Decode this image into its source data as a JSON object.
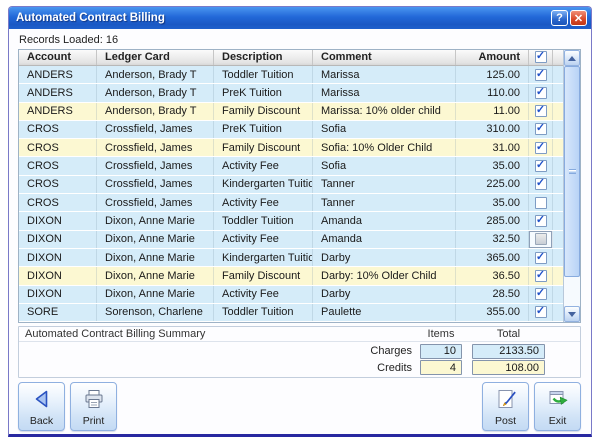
{
  "titlebar": {
    "title": "Automated Contract Billing",
    "help_glyph": "?",
    "close_glyph": "✕"
  },
  "records_loaded": "Records Loaded: 16",
  "table": {
    "columns": [
      "Account",
      "Ledger Card",
      "Description",
      "Comment",
      "Amount"
    ],
    "select_all_checked": true,
    "rows": [
      {
        "account": "ANDERS",
        "ledger": "Anderson, Brady T",
        "description": "Toddler Tuition",
        "comment": "Marissa",
        "amount": "125.00",
        "checked": true,
        "highlight": false,
        "focused": false
      },
      {
        "account": "ANDERS",
        "ledger": "Anderson, Brady T",
        "description": "PreK Tuition",
        "comment": "Marissa",
        "amount": "110.00",
        "checked": true,
        "highlight": false,
        "focused": false
      },
      {
        "account": "ANDERS",
        "ledger": "Anderson, Brady T",
        "description": "Family Discount",
        "comment": "Marissa: 10% older child",
        "amount": "11.00",
        "checked": true,
        "highlight": true,
        "focused": false
      },
      {
        "account": "CROS",
        "ledger": "Crossfield, James",
        "description": "PreK Tuition",
        "comment": "Sofia",
        "amount": "310.00",
        "checked": true,
        "highlight": false,
        "focused": false
      },
      {
        "account": "CROS",
        "ledger": "Crossfield, James",
        "description": "Family Discount",
        "comment": "Sofia: 10% Older Child",
        "amount": "31.00",
        "checked": true,
        "highlight": true,
        "focused": false
      },
      {
        "account": "CROS",
        "ledger": "Crossfield, James",
        "description": "Activity Fee",
        "comment": "Sofia",
        "amount": "35.00",
        "checked": true,
        "highlight": false,
        "focused": false
      },
      {
        "account": "CROS",
        "ledger": "Crossfield, James",
        "description": "Kindergarten Tuition",
        "comment": "Tanner",
        "amount": "225.00",
        "checked": true,
        "highlight": false,
        "focused": false
      },
      {
        "account": "CROS",
        "ledger": "Crossfield, James",
        "description": "Activity Fee",
        "comment": "Tanner",
        "amount": "35.00",
        "checked": false,
        "highlight": false,
        "focused": false
      },
      {
        "account": "DIXON",
        "ledger": "Dixon, Anne Marie",
        "description": "Toddler Tuition",
        "comment": "Amanda",
        "amount": "285.00",
        "checked": true,
        "highlight": false,
        "focused": false
      },
      {
        "account": "DIXON",
        "ledger": "Dixon, Anne Marie",
        "description": "Activity Fee",
        "comment": "Amanda",
        "amount": "32.50",
        "checked": false,
        "highlight": false,
        "focused": true
      },
      {
        "account": "DIXON",
        "ledger": "Dixon, Anne Marie",
        "description": "Kindergarten Tuition",
        "comment": "Darby",
        "amount": "365.00",
        "checked": true,
        "highlight": false,
        "focused": false
      },
      {
        "account": "DIXON",
        "ledger": "Dixon, Anne Marie",
        "description": "Family Discount",
        "comment": "Darby: 10% Older Child",
        "amount": "36.50",
        "checked": true,
        "highlight": true,
        "focused": false
      },
      {
        "account": "DIXON",
        "ledger": "Dixon, Anne Marie",
        "description": "Activity Fee",
        "comment": "Darby",
        "amount": "28.50",
        "checked": true,
        "highlight": false,
        "focused": false
      },
      {
        "account": "SORE",
        "ledger": "Sorenson, Charlene",
        "description": "Toddler Tuition",
        "comment": "Paulette",
        "amount": "355.00",
        "checked": true,
        "highlight": false,
        "focused": false
      }
    ]
  },
  "summary": {
    "title": "Automated Contract Billing Summary",
    "items_header": "Items",
    "total_header": "Total",
    "charges": {
      "label": "Charges",
      "items": "10",
      "total": "2133.50"
    },
    "credits": {
      "label": "Credits",
      "items": "4",
      "total": "108.00"
    }
  },
  "footer": {
    "buttons": [
      {
        "label": "Back",
        "icon": "back-arrow-icon"
      },
      {
        "label": "Print",
        "icon": "printer-icon"
      },
      {
        "label": "Post",
        "icon": "post-pen-icon"
      },
      {
        "label": "Exit",
        "icon": "exit-icon"
      }
    ]
  },
  "colors": {
    "row_blue": "#d5ecf9",
    "row_yellow": "#fcf8d2",
    "titlebar_blue": "#2268d8",
    "close_red": "#d84828",
    "bottom_border_navy": "#2828a0",
    "check_blue": "#2253c9"
  }
}
